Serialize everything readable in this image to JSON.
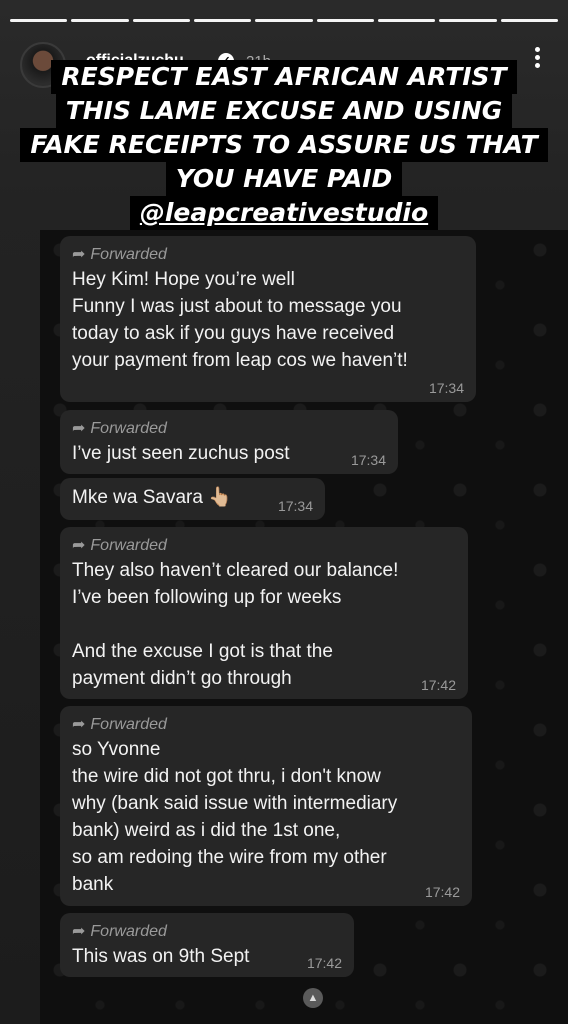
{
  "story": {
    "username": "officialzuchu",
    "time_ago": "21h",
    "progress_segments": 9,
    "progress_done": 9
  },
  "overlay": {
    "lines": [
      "RESPECT EAST AFRICAN ARTIST",
      "THIS LAME EXCUSE AND USING",
      "FAKE RECEIPTS TO ASSURE US THAT",
      "YOU HAVE PAID"
    ],
    "mention": "@leapcreativestudio"
  },
  "messages": [
    {
      "forwarded": "Forwarded",
      "text": "Hey Kim! Hope you’re well\nFunny I was just about to message you\ntoday to ask if you guys have received\nyour payment from leap cos we haven’t!",
      "time": "17:34"
    },
    {
      "forwarded": "Forwarded",
      "text": "I’ve just seen zuchus post",
      "time": "17:34"
    },
    {
      "forwarded": "",
      "text": "Mke wa Savara 👆🏼",
      "time": "17:34"
    },
    {
      "forwarded": "Forwarded",
      "text": "They also haven’t cleared our balance!\nI’ve been following up for weeks\n\nAnd the excuse I got is that the\npayment didn’t go through",
      "time": "17:42"
    },
    {
      "forwarded": "Forwarded",
      "text": "so Yvonne\nthe wire did not got thru, i don't know\nwhy (bank said issue with intermediary\nbank) weird as i did the 1st one,\nso am redoing the wire from my other\nbank",
      "time": "17:42"
    },
    {
      "forwarded": "Forwarded",
      "text": "This was on 9th Sept",
      "time": "17:42"
    }
  ]
}
